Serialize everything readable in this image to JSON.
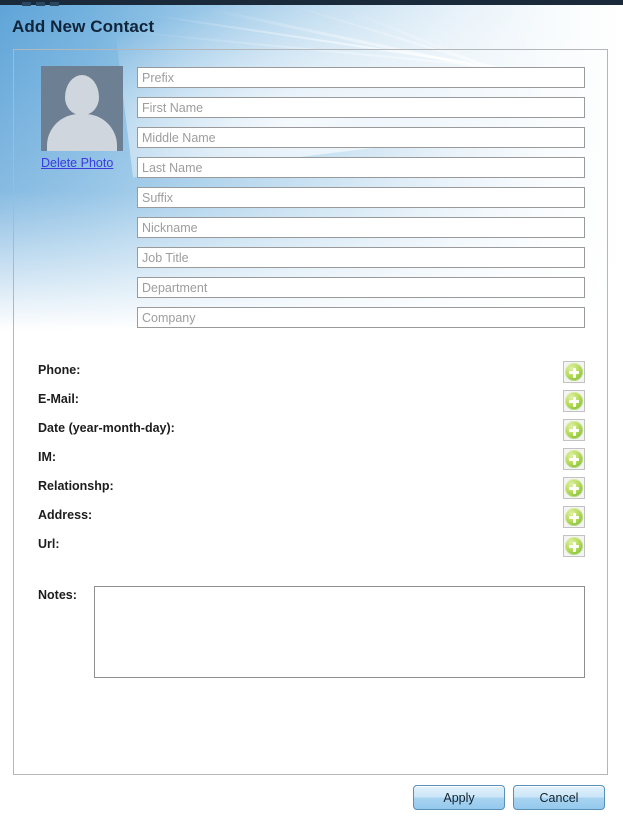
{
  "window": {
    "title": "Add New Contact"
  },
  "photo": {
    "avatar_icon": "person-silhouette-icon",
    "delete_link": "Delete Photo"
  },
  "name_fields": [
    {
      "name": "prefix",
      "placeholder": "Prefix",
      "value": ""
    },
    {
      "name": "first-name",
      "placeholder": "First Name",
      "value": ""
    },
    {
      "name": "middle-name",
      "placeholder": "Middle Name",
      "value": ""
    },
    {
      "name": "last-name",
      "placeholder": "Last Name",
      "value": ""
    },
    {
      "name": "suffix",
      "placeholder": "Suffix",
      "value": ""
    },
    {
      "name": "nickname",
      "placeholder": "Nickname",
      "value": ""
    },
    {
      "name": "job-title",
      "placeholder": "Job Title",
      "value": ""
    },
    {
      "name": "department",
      "placeholder": "Department",
      "value": ""
    },
    {
      "name": "company",
      "placeholder": "Company",
      "value": ""
    }
  ],
  "multi_rows": [
    {
      "name": "phone",
      "label": "Phone:",
      "add_icon": "plus-circle-icon"
    },
    {
      "name": "email",
      "label": "E-Mail:",
      "add_icon": "plus-circle-icon"
    },
    {
      "name": "date",
      "label": "Date (year-month-day):",
      "add_icon": "plus-circle-icon"
    },
    {
      "name": "im",
      "label": "IM:",
      "add_icon": "plus-circle-icon"
    },
    {
      "name": "relationship",
      "label": "Relationshp:",
      "add_icon": "plus-circle-icon"
    },
    {
      "name": "address",
      "label": "Address:",
      "add_icon": "plus-circle-icon"
    },
    {
      "name": "url",
      "label": "Url:",
      "add_icon": "plus-circle-icon"
    }
  ],
  "notes": {
    "label": "Notes:",
    "value": "",
    "placeholder": ""
  },
  "footer": {
    "apply_label": "Apply",
    "cancel_label": "Cancel"
  },
  "colors": {
    "accent_blue": "#5fa4d8",
    "title_text": "#10243a",
    "link_blue": "#3b3bdd",
    "add_green": "#8fc63d",
    "button_blue": "#a9d4f0",
    "panel_border": "#b3b7ba",
    "field_border": "#9a9a9a",
    "placeholder_grey": "#9d9d9d",
    "avatar_bg": "#6d7f92",
    "avatar_fg": "#cfd6dd"
  }
}
